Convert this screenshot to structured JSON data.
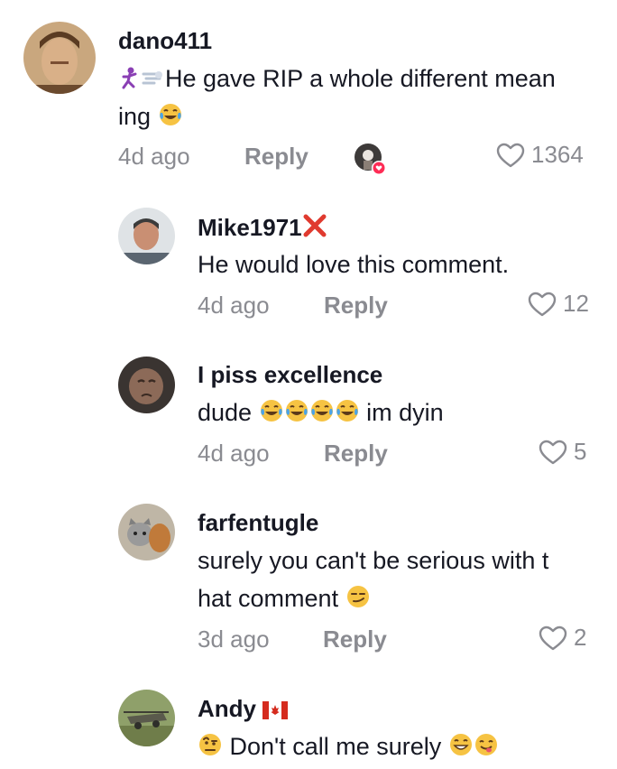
{
  "colors": {
    "text": "#161823",
    "muted": "#8a8b91",
    "like_badge": "#fe2c55"
  },
  "comments": [
    {
      "username": "dano411",
      "text_line1": "He gave RIP a whole different mean",
      "text_line2": "ing",
      "lead_icons": [
        "dancing-man-emoji",
        "dash-emoji"
      ],
      "trail_icon": "tears-of-joy-emoji",
      "time": "4d ago",
      "reply_label": "Reply",
      "likes": "1364",
      "creator_liked": true
    },
    {
      "username": "Mike1971",
      "name_icon": "cross-mark-emoji",
      "text_line1": "He would love this comment.",
      "time": "4d ago",
      "reply_label": "Reply",
      "likes": "12"
    },
    {
      "username": "I piss excellence",
      "text_before": "dude",
      "emoji_run": [
        "tears-of-joy-emoji",
        "tears-of-joy-emoji",
        "tears-of-joy-emoji",
        "tears-of-joy-emoji"
      ],
      "text_after": "im dyin",
      "time": "4d ago",
      "reply_label": "Reply",
      "likes": "5"
    },
    {
      "username": "farfentugle",
      "text_line1": "surely you can't be serious with t",
      "text_line2": "hat comment",
      "trail_icon": "smirk-emoji",
      "time": "3d ago",
      "reply_label": "Reply",
      "likes": "2"
    },
    {
      "username": "Andy",
      "name_icon": "canada-flag-emoji",
      "lead_icon": "raised-eyebrow-emoji",
      "text_line1": "Don't call me surely",
      "trail_icons": [
        "grinning-emoji",
        "yum-emoji"
      ]
    }
  ]
}
